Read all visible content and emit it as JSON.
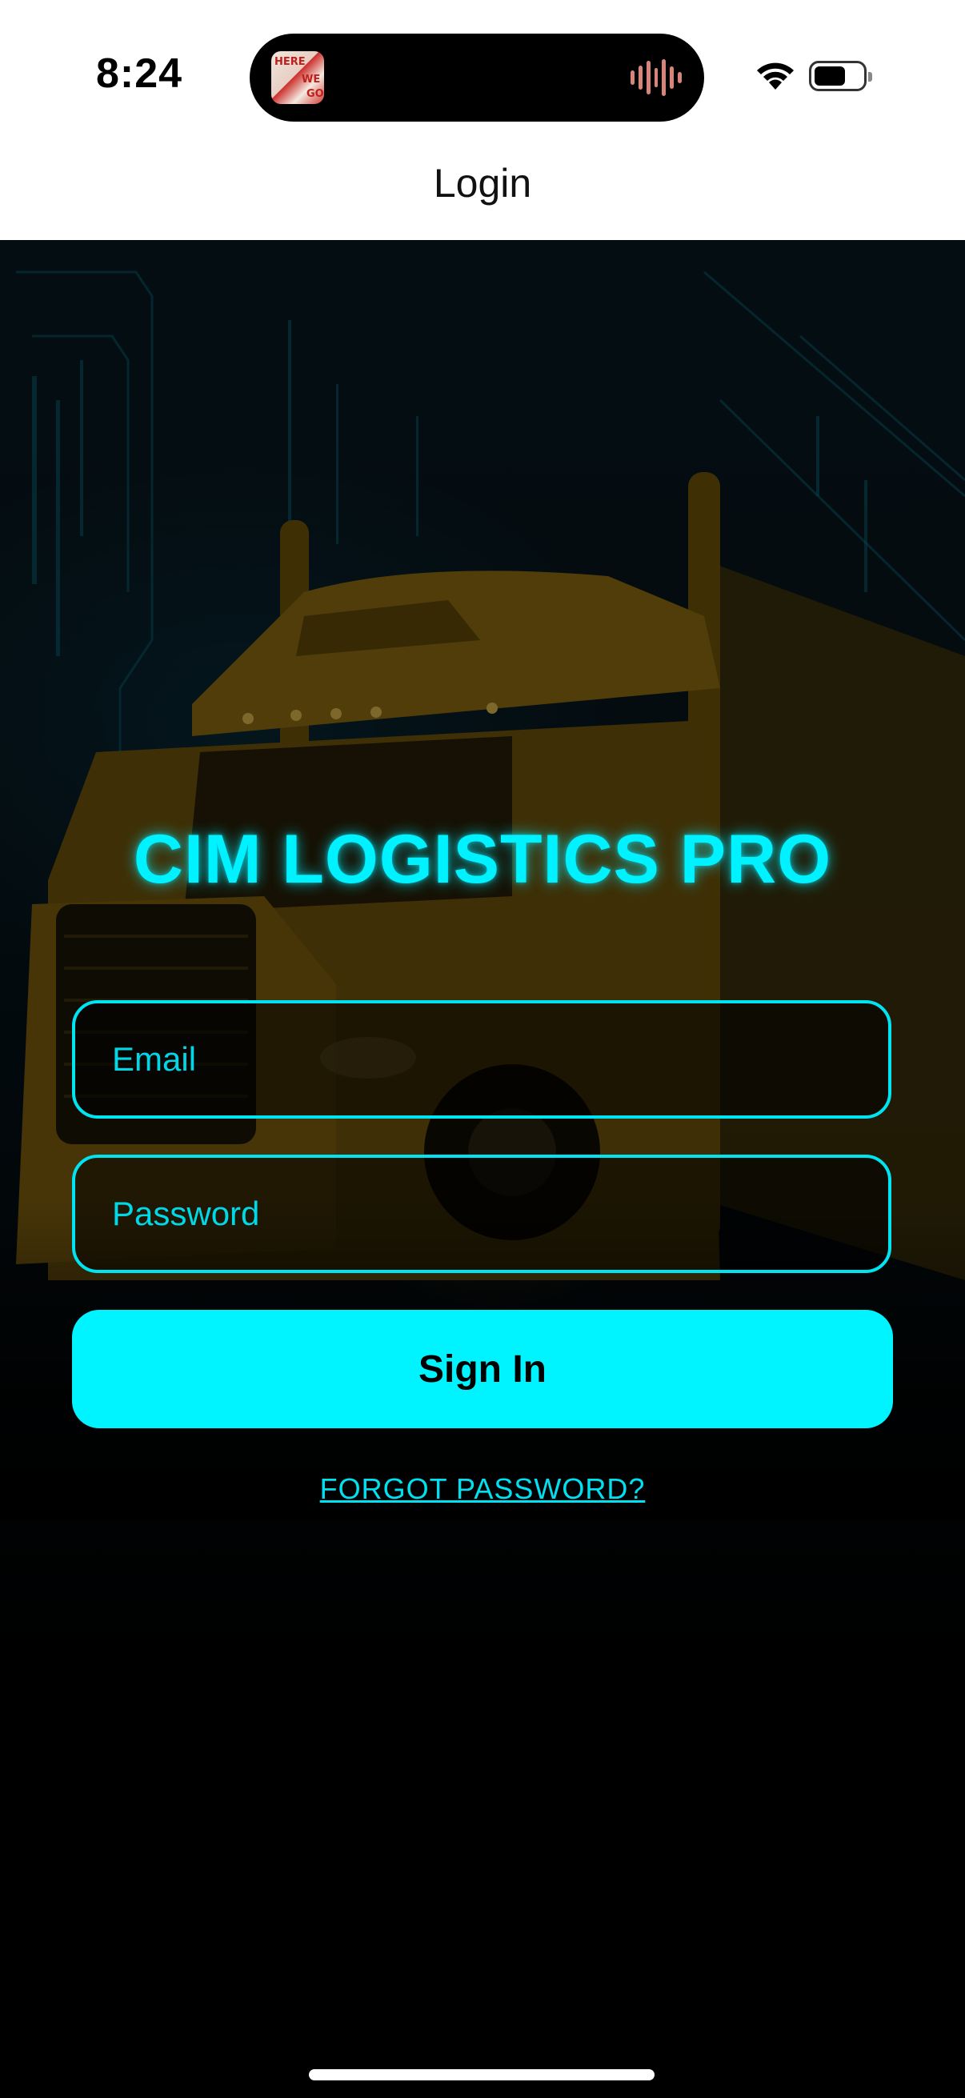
{
  "status_bar": {
    "time": "8:24",
    "album_art_text": "HERE WE GO"
  },
  "nav": {
    "title": "Login"
  },
  "login": {
    "brand": "CIM LOGISTICS PRO",
    "email_placeholder": "Email",
    "password_placeholder": "Password",
    "sign_in_label": "Sign In",
    "forgot_label": "FORGOT PASSWORD?"
  },
  "colors": {
    "accent": "#00F4FF",
    "background": "#000000",
    "truck": "#8A6A10"
  },
  "icons": [
    "now-playing-album-icon",
    "audio-waveform-icon",
    "wifi-icon",
    "battery-icon"
  ]
}
